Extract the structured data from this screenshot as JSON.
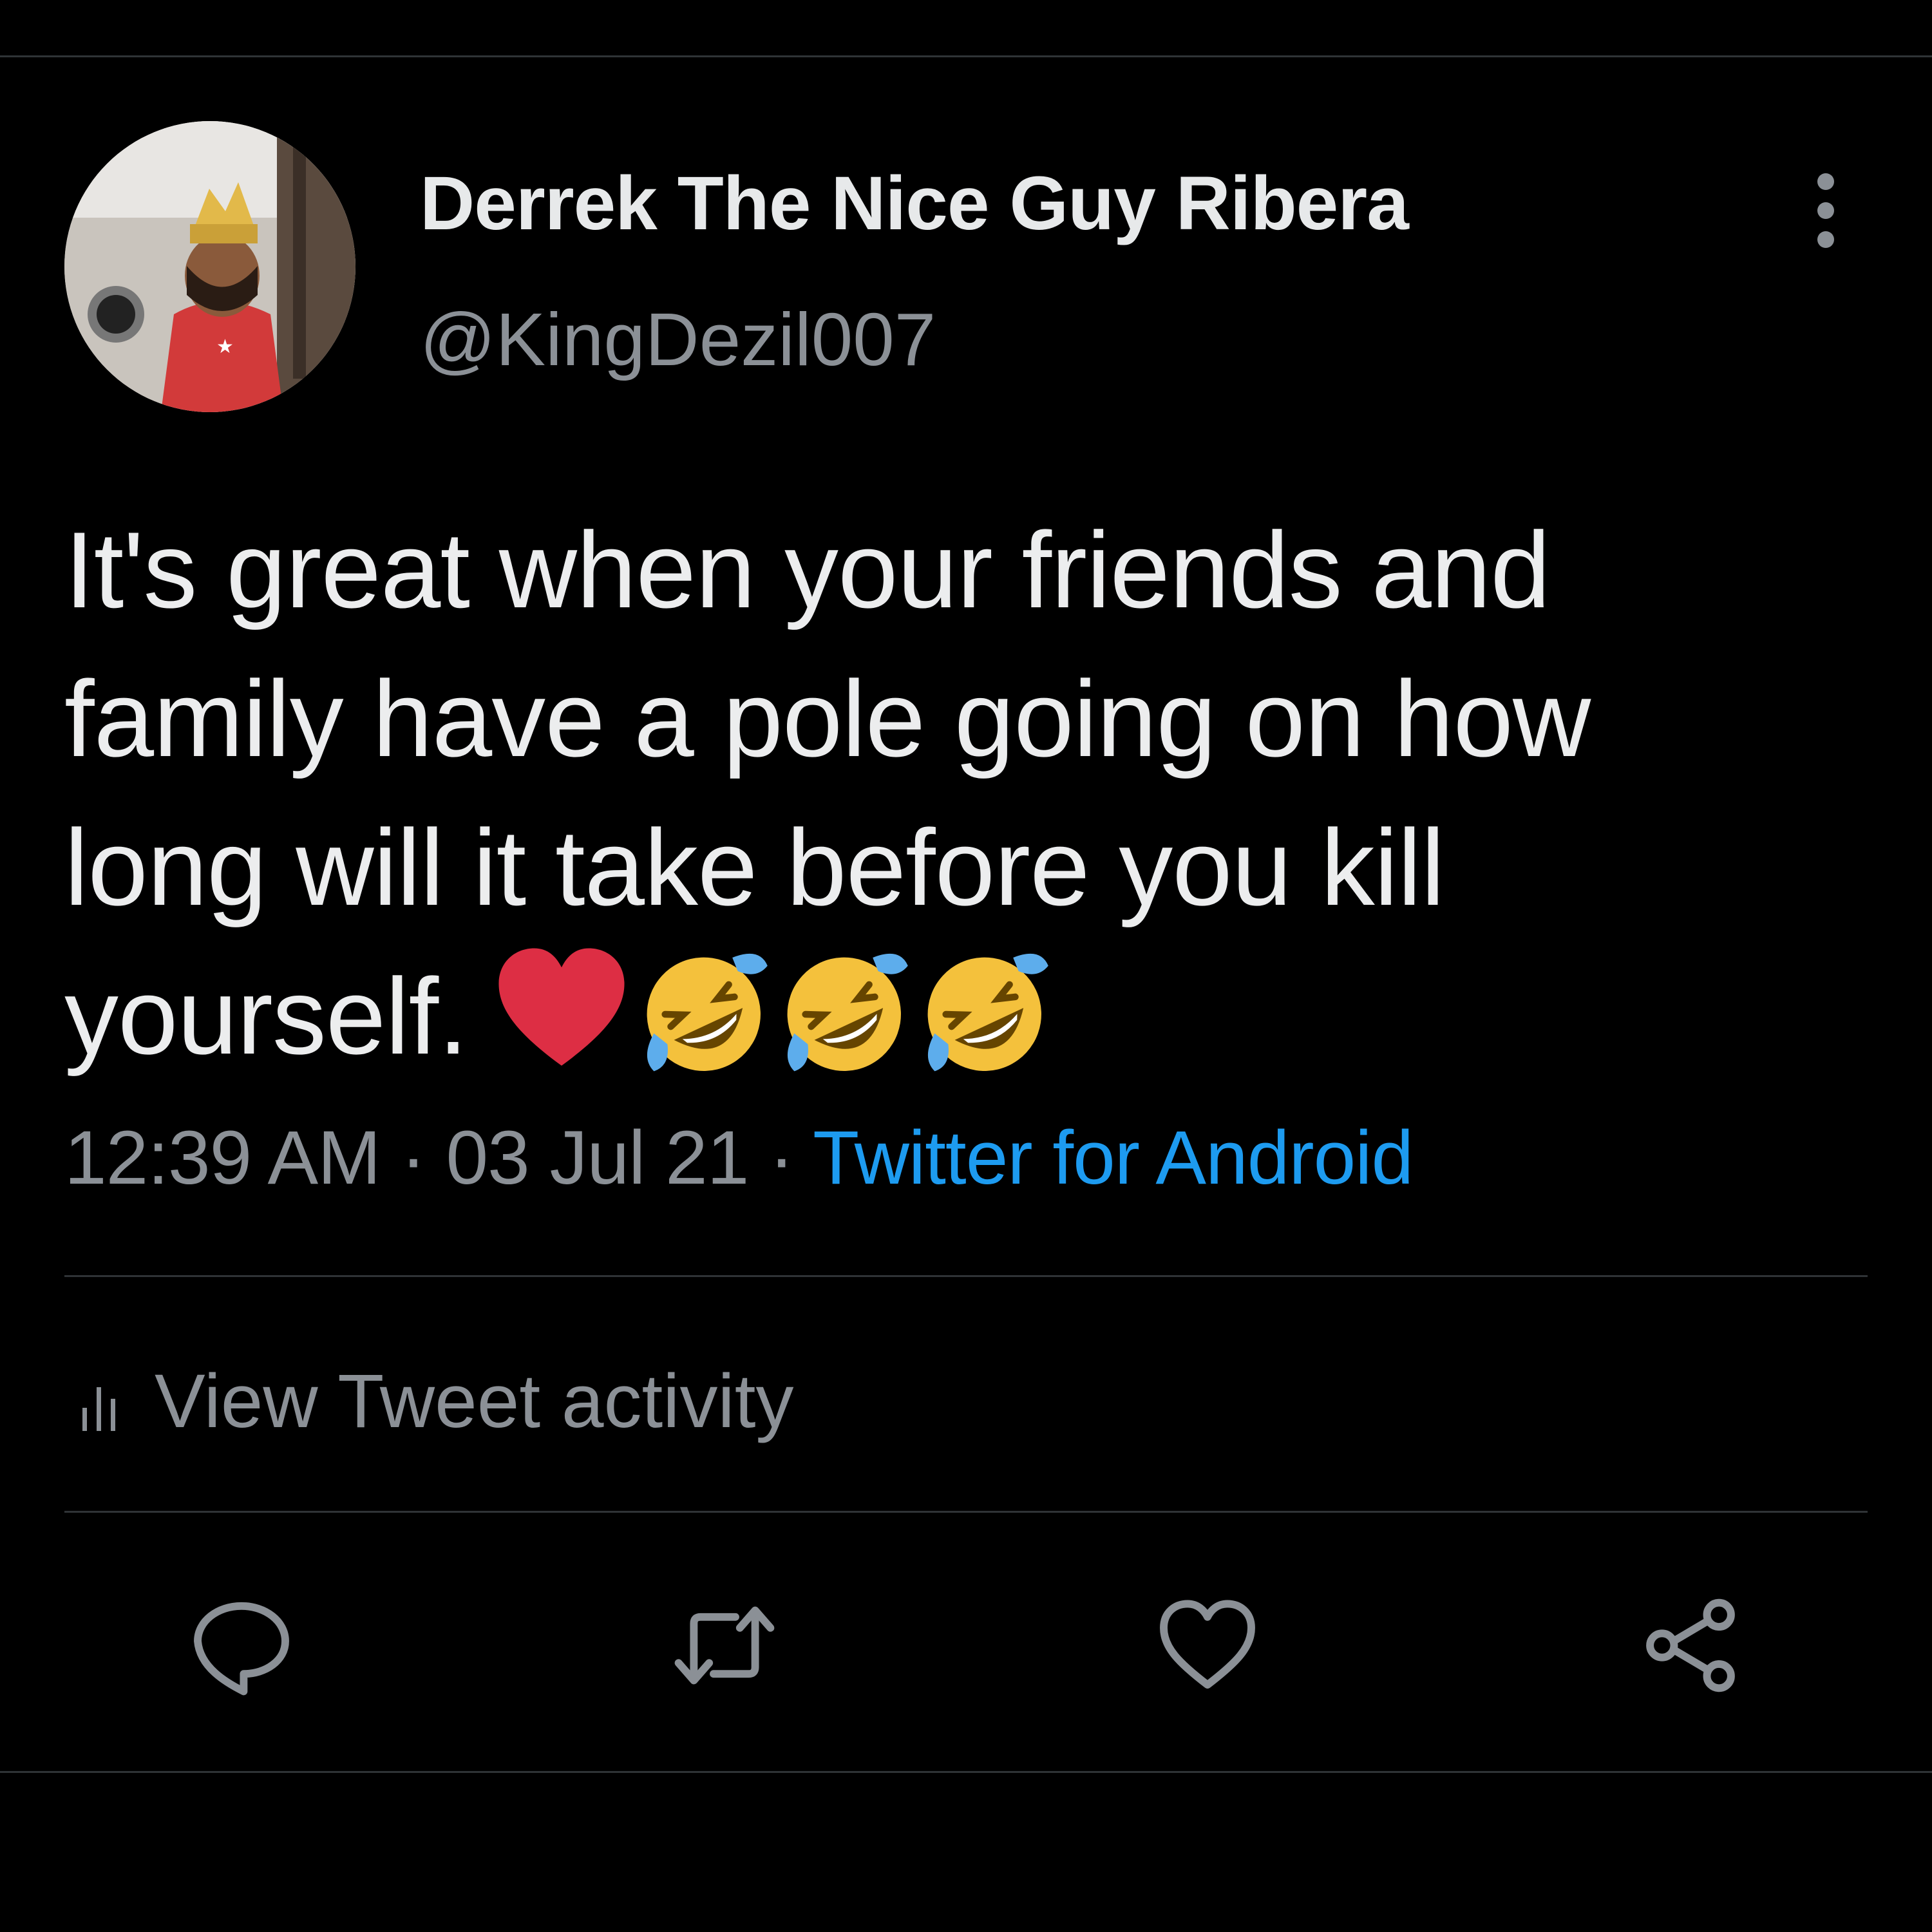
{
  "tweet": {
    "author_name": "Derrek The Nice Guy Ribera",
    "author_handle": "@KingDezil007",
    "text_lines": [
      "It's great when your friends and",
      "family have a pole going on how",
      "long will it take before you kill",
      "yourself."
    ],
    "emojis": [
      "heart-icon",
      "rolling-on-floor-laughing-icon",
      "rolling-on-floor-laughing-icon",
      "rolling-on-floor-laughing-icon"
    ],
    "time": "12:39 AM",
    "separator": "·",
    "date": "03 Jul 21",
    "source": "Twitter for Android"
  },
  "activity": {
    "label": "View Tweet activity",
    "icon": "bar-chart-icon"
  },
  "actions": [
    {
      "name": "reply",
      "icon": "comment-icon"
    },
    {
      "name": "retweet",
      "icon": "retweet-icon"
    },
    {
      "name": "like",
      "icon": "heart-outline-icon"
    },
    {
      "name": "share",
      "icon": "share-icon"
    }
  ],
  "colors": {
    "background": "#000000",
    "text": "#e7e9ea",
    "secondary": "#8b9096",
    "link": "#1d9bf0",
    "divider": "#2f3336",
    "heart": "#dd2e44",
    "emoji_face": "#f4c13c",
    "tears": "#5dadec"
  }
}
